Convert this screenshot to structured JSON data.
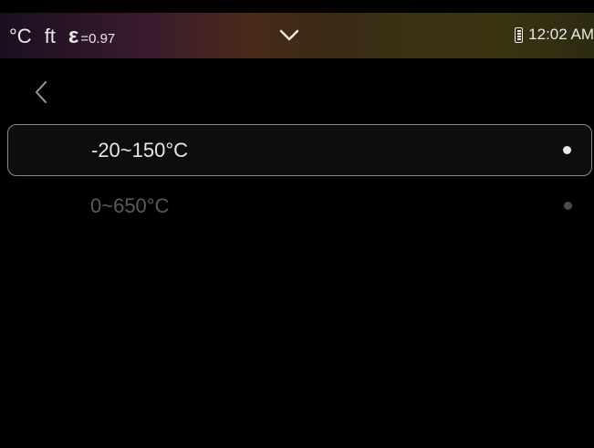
{
  "status_bar": {
    "temp_unit": "°C",
    "distance_unit": "ft",
    "emissivity_symbol": "ε",
    "emissivity_value": "=0.97",
    "dropdown_icon": "chevron-down-icon",
    "battery_icon": "battery-icon",
    "time": "12:02 AM"
  },
  "nav": {
    "back_icon": "chevron-left-icon"
  },
  "range_options": [
    {
      "label": "-20~150°C",
      "selected": true
    },
    {
      "label": "0~650°C",
      "selected": false
    }
  ],
  "colors": {
    "background": "#000000",
    "selected_text": "#e6e6e6",
    "unselected_text": "#5a5a5a",
    "border": "#8a8a8a"
  }
}
